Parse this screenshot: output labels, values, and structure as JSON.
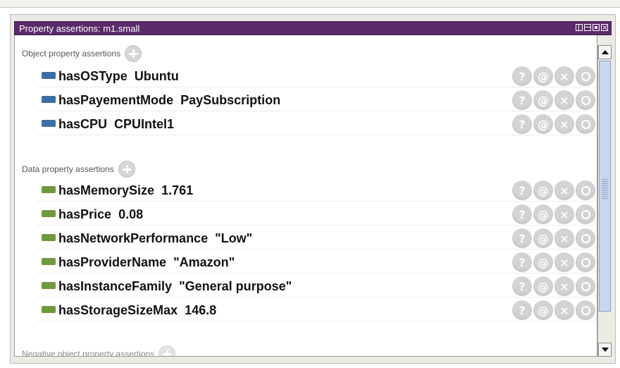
{
  "window": {
    "title": "Property assertions: m1.small"
  },
  "sections": {
    "object": {
      "label": "Object property assertions"
    },
    "data": {
      "label": "Data property assertions"
    },
    "negative": {
      "label": "Negative object property assertions"
    }
  },
  "object_assertions": [
    {
      "property": "hasOSType",
      "value": "Ubuntu"
    },
    {
      "property": "hasPayementMode",
      "value": "PaySubscription"
    },
    {
      "property": "hasCPU",
      "value": "CPUIntel1"
    }
  ],
  "data_assertions": [
    {
      "property": "hasMemorySize",
      "value": "1.761"
    },
    {
      "property": "hasPrice",
      "value": "0.08"
    },
    {
      "property": "hasNetworkPerformance",
      "value": "\"Low\""
    },
    {
      "property": "hasProviderName",
      "value": "\"Amazon\""
    },
    {
      "property": "hasInstanceFamily",
      "value": "\"General purpose\""
    },
    {
      "property": "hasStorageSizeMax",
      "value": "146.8"
    }
  ],
  "row_actions": {
    "explain": "?",
    "annotate": "@",
    "delete": "×"
  },
  "colors": {
    "titlebar": "#5b2a6a",
    "object_swatch": "#3d6fa5",
    "data_swatch": "#6f9a3b",
    "action_button": "#d3d3d3"
  }
}
